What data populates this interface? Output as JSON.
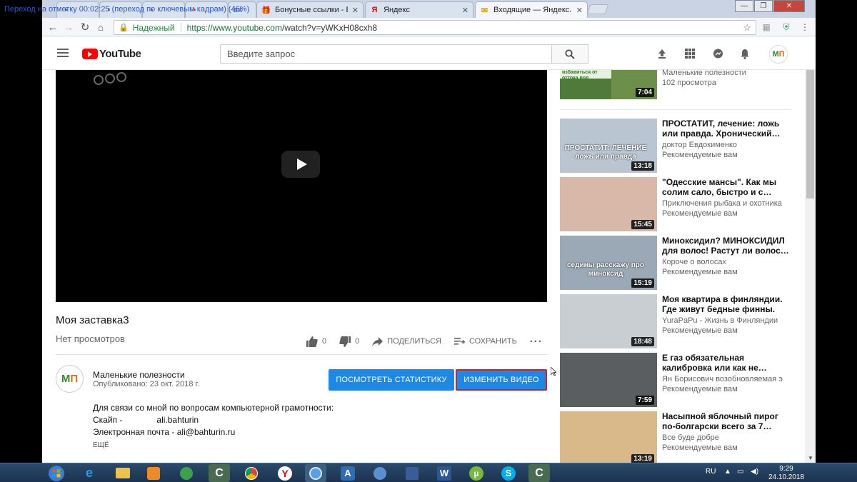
{
  "overlay": {
    "text": "Переход на отметку 00:02:25 (переход по ключевым кадрам) (46%)"
  },
  "browser": {
    "tabs": [
      {
        "label": "Бонусные ссылки - Вер",
        "icon": "gift-icon",
        "active": false
      },
      {
        "label": "Яндекс",
        "icon": "yandex-icon",
        "active": false
      },
      {
        "label": "Входящие — Яндекс.По",
        "icon": "mail-icon",
        "active": true
      }
    ],
    "secure_label": "Надежный",
    "url_host": "https://www.youtube.com",
    "url_path": "/watch?v=yWKxH08cxh8"
  },
  "youtube": {
    "logo": "YouTube",
    "search_placeholder": "Введите запрос",
    "avatar_letters": [
      "М",
      "П"
    ]
  },
  "video": {
    "title": "Моя заставка3",
    "views": "Нет просмотров",
    "likes": "0",
    "dislikes": "0",
    "share_label": "ПОДЕЛИТЬСЯ",
    "save_label": "СОХРАНИТЬ"
  },
  "channel": {
    "name": "Маленькие полезности",
    "published": "Опубликовано: 23 окт. 2018 г.",
    "stats_button": "ПОСМОТРЕТЬ СТАТИСТИКУ",
    "edit_button": "ИЗМЕНИТЬ ВИДЕО"
  },
  "description": {
    "line1": "Для связи со мной по вопросам компьютерной грамотности:",
    "skype_label": "Скайп -",
    "skype_value": "ali.bahturin",
    "email_line": "Электронная почта - ali@bahturin.ru",
    "more": "ЕЩЁ"
  },
  "recommended_top": {
    "duration": "7:04",
    "channel": "Маленькие полезности",
    "views": "102 просмотра",
    "thumb_text": "избавиться от оттока вод"
  },
  "recommended": [
    {
      "title": "ПРОСТАТИТ, лечение: ложь или правда. Хронический…",
      "channel": "доктор Евдокименко",
      "meta": "Рекомендуемые вам",
      "duration": "13:18",
      "thumb_text": "ПРОСТАТИТ: ЛЕЧЕНИЕ ложь или правда",
      "color": "#b9c6d2"
    },
    {
      "title": "\"Одесские мансы\". Как мы солим сало, быстро и с…",
      "channel": "Приключения рыбака и охотника",
      "meta": "Рекомендуемые вам",
      "duration": "15:45",
      "thumb_text": "",
      "color": "#d8b8a8"
    },
    {
      "title": "Миноксидил? МИНОКСИДИЛ для волос! Растут ли волос…",
      "channel": "Короче о волосах",
      "meta": "Рекомендуемые вам",
      "duration": "15:19",
      "thumb_text": "седины расскажу про миноксид",
      "color": "#9aa9b5"
    },
    {
      "title": "Моя квартира в финляндии. Где живут бедные финны.",
      "channel": "YuraPaPu - Жизнь в Финляндии",
      "meta": "Рекомендуемые вам",
      "duration": "18:48",
      "thumb_text": "",
      "color": "#c9ced3"
    },
    {
      "title": "Е газ обязательная калибровка или как не…",
      "channel": "Ян Борисович возобновляемая э",
      "meta": "Рекомендуемые вам",
      "duration": "7:59",
      "thumb_text": "",
      "color": "#5b5e60"
    },
    {
      "title": "Насыпной яблочный пирог по-болгарски всего за 7…",
      "channel": "Все буде добре",
      "meta": "Рекомендуемые вам",
      "duration": "13:19",
      "thumb_text": "",
      "color": "#d9b88a"
    }
  ],
  "taskbar": {
    "lang": "RU",
    "time": "9:29",
    "date": "24.10.2018"
  }
}
